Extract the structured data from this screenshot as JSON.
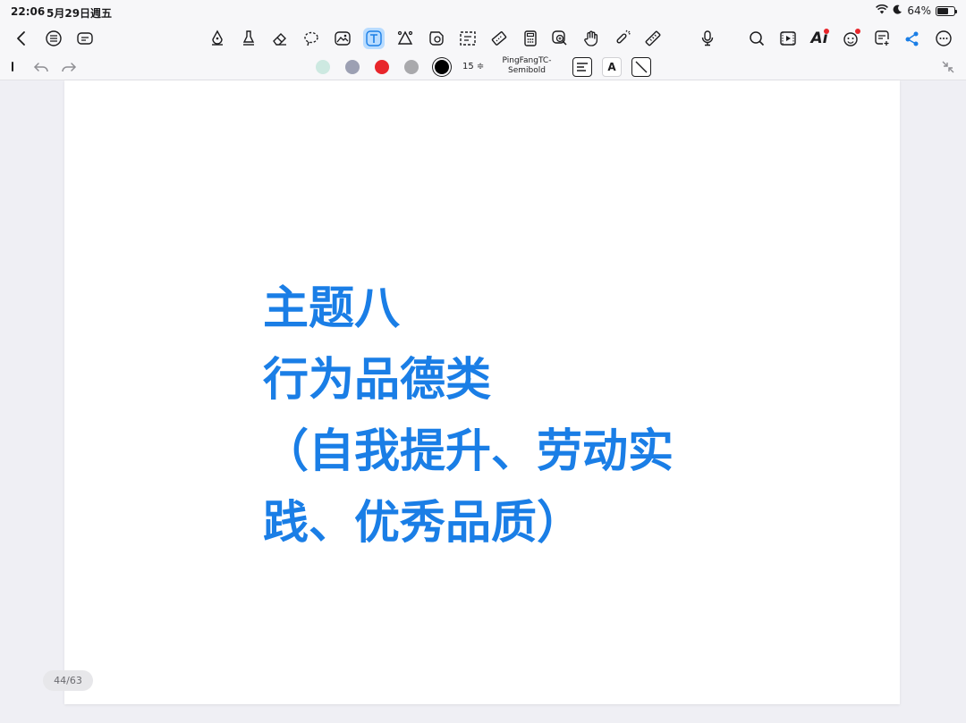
{
  "status_bar": {
    "time": "22:06",
    "date": "5月29日週五",
    "battery_text": "64%",
    "battery_level": 0.64
  },
  "toolbar": {
    "left_icons": [
      "back-chevron-icon",
      "outline-list-icon",
      "page-view-icon"
    ],
    "tool_icons": [
      "pen-icon",
      "highlighter-icon",
      "eraser-icon",
      "lasso-icon",
      "image-icon",
      "text-tool-icon",
      "shape-icon",
      "sticker-icon",
      "selection-icon",
      "tape-icon",
      "calculator-icon",
      "zoom-window-icon",
      "hand-pan-icon",
      "laser-pointer-icon",
      "ruler-icon"
    ],
    "right_icons": [
      "microphone-icon",
      "search-icon",
      "presentation-icon",
      "ai-icon",
      "collaborate-icon",
      "add-page-icon",
      "share-icon",
      "more-icon"
    ],
    "ai_label": "Ai",
    "active_tool": "text-tool-icon",
    "accent_color": "#1a7ee6"
  },
  "subbar": {
    "colors": [
      "#cde9e1",
      "#9ca0b3",
      "#e8262b",
      "#a9a9ac",
      "#000000"
    ],
    "selected_color": "#000000",
    "font_size": "15 ≑",
    "font_name_line1": "PingFangTC-",
    "font_name_line2": "Semibold",
    "align_label": "≡",
    "bold_label": "A",
    "stroke_label": "╲"
  },
  "slide": {
    "text": "主题八\n行为品德类\n（自我提升、劳动实\n践、优秀品质）",
    "color": "#1a7ee6"
  },
  "page_indicator": "44/63"
}
